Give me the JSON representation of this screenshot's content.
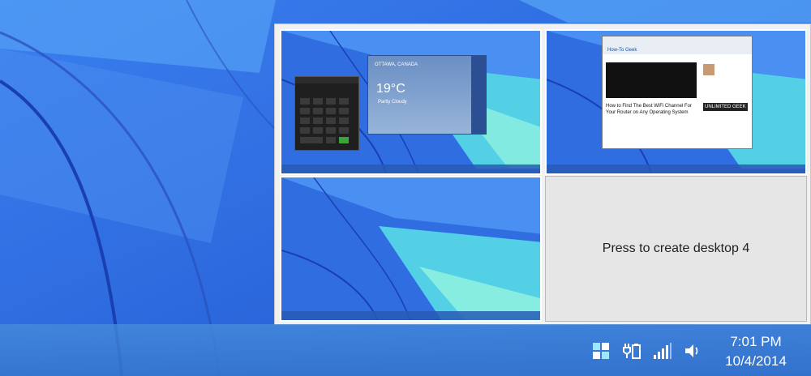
{
  "task_view": {
    "desktops": [
      {
        "id": 1,
        "windows": [
          "calculator",
          "weather"
        ]
      },
      {
        "id": 2,
        "windows": [
          "browser"
        ]
      },
      {
        "id": 3,
        "windows": []
      }
    ],
    "new_desktop_label": "Press to create desktop 4"
  },
  "weather": {
    "city": "OTTAWA, CANADA",
    "temperature": "19°C",
    "condition": "Partly Cloudy"
  },
  "browser": {
    "site_name": "How-To Geek",
    "headline": "How to Find The Best WiFi Channel For Your Router on Any Operating System",
    "sidebar_box": "UNLIMITED GEEK"
  },
  "system_tray": {
    "icons": [
      "task-view-icon",
      "power-icon",
      "network-signal-icon",
      "volume-icon"
    ],
    "time": "7:01 PM",
    "date": "10/4/2014"
  },
  "colors": {
    "wallpaper_blue": "#2a6fe0",
    "wallpaper_cyan": "#4ad6e8",
    "taskbar": "#4a8ed6"
  }
}
